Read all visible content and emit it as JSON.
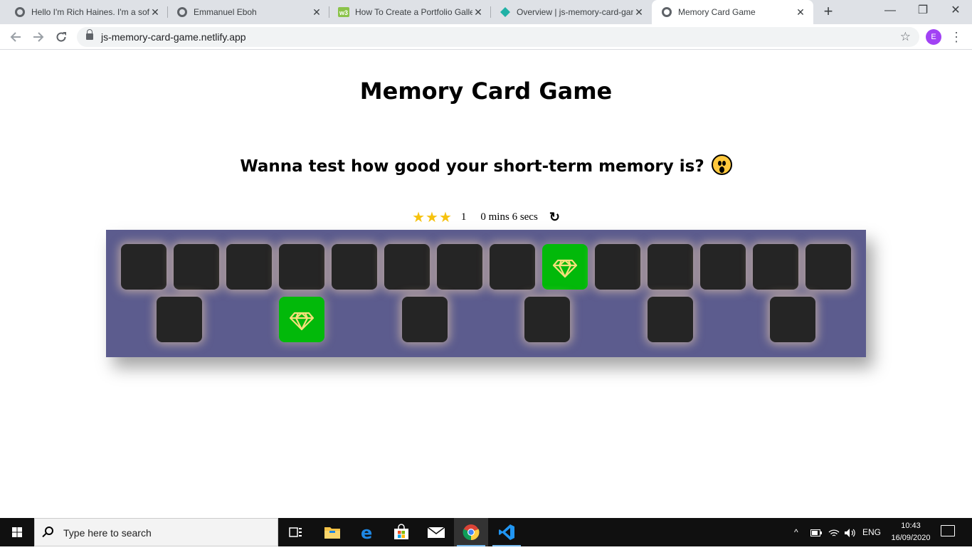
{
  "browser": {
    "tabs": [
      {
        "title": "Hello I'm Rich Haines. I'm a software",
        "icon": "globe-icon"
      },
      {
        "title": "Emmanuel Eboh",
        "icon": "globe-icon"
      },
      {
        "title": "How To Create a Portfolio Gallery",
        "icon": "w3schools-icon"
      },
      {
        "title": "Overview | js-memory-card-game",
        "icon": "netlify-icon"
      },
      {
        "title": "Memory Card Game",
        "icon": "globe-icon",
        "active": true
      }
    ],
    "new_tab": "+",
    "controls": {
      "minimize": "—",
      "maximize": "❐",
      "close": "✕"
    },
    "url": "js-memory-card-game.netlify.app",
    "profile_initial": "E"
  },
  "game": {
    "title": "Memory Card Game",
    "subtitle": "Wanna test how good your short-term memory is?",
    "emoji": "hushed-face-emoji",
    "stars": "★★★",
    "moves": "1",
    "timer": "0 mins 6 secs",
    "restart_icon": "↻",
    "colors": {
      "deck": "#5c5c8e",
      "card_back": "#252525",
      "card_matched": "#02b90a",
      "diamond": "#f5e07a"
    },
    "cards": [
      {
        "state": "hidden"
      },
      {
        "state": "hidden"
      },
      {
        "state": "hidden"
      },
      {
        "state": "hidden"
      },
      {
        "state": "hidden"
      },
      {
        "state": "hidden"
      },
      {
        "state": "hidden"
      },
      {
        "state": "hidden"
      },
      {
        "state": "matched",
        "icon": "diamond-icon"
      },
      {
        "state": "hidden"
      },
      {
        "state": "hidden"
      },
      {
        "state": "hidden"
      },
      {
        "state": "hidden"
      },
      {
        "state": "hidden"
      },
      {
        "state": "hidden"
      },
      {
        "state": "matched",
        "icon": "diamond-icon"
      },
      {
        "state": "hidden"
      },
      {
        "state": "hidden"
      },
      {
        "state": "hidden"
      },
      {
        "state": "hidden"
      }
    ]
  },
  "taskbar": {
    "search_placeholder": "Type here to search",
    "apps": [
      "task-view-icon",
      "file-explorer-icon",
      "edge-icon",
      "store-icon",
      "mail-icon",
      "chrome-icon",
      "vscode-icon"
    ],
    "language": "ENG",
    "time": "10:43",
    "date": "16/09/2020"
  }
}
